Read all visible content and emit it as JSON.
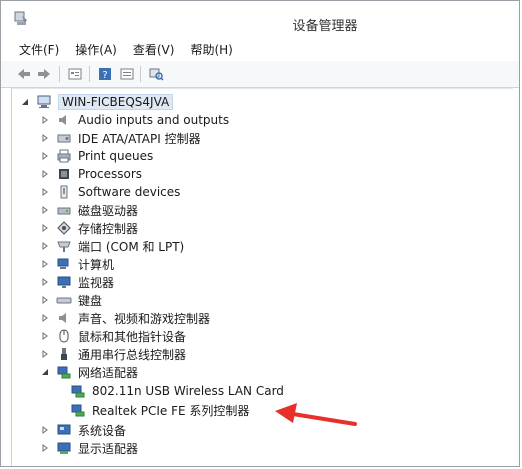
{
  "window": {
    "title": "设备管理器"
  },
  "menu": [
    {
      "label": "文件(F)"
    },
    {
      "label": "操作(A)"
    },
    {
      "label": "查看(V)"
    },
    {
      "label": "帮助(H)"
    }
  ],
  "toolbar": {
    "buttons": [
      "back-icon",
      "forward-icon",
      "properties-icon",
      "help-icon",
      "details-icon",
      "scan-hardware-icon"
    ]
  },
  "tree": {
    "root": "WIN-FICBEQS4JVA",
    "items": [
      {
        "label": "Audio inputs and outputs",
        "icon": "speaker-icon",
        "expanded": false
      },
      {
        "label": "IDE ATA/ATAPI 控制器",
        "icon": "ide-controller-icon",
        "expanded": false
      },
      {
        "label": "Print queues",
        "icon": "printer-icon",
        "expanded": false
      },
      {
        "label": "Processors",
        "icon": "processor-icon",
        "expanded": false
      },
      {
        "label": "Software devices",
        "icon": "software-device-icon",
        "expanded": false
      },
      {
        "label": "磁盘驱动器",
        "icon": "disk-drive-icon",
        "expanded": false
      },
      {
        "label": "存储控制器",
        "icon": "storage-controller-icon",
        "expanded": false
      },
      {
        "label": "端口 (COM 和 LPT)",
        "icon": "port-icon",
        "expanded": false
      },
      {
        "label": "计算机",
        "icon": "computer-icon",
        "expanded": false
      },
      {
        "label": "监视器",
        "icon": "monitor-icon",
        "expanded": false
      },
      {
        "label": "键盘",
        "icon": "keyboard-icon",
        "expanded": false
      },
      {
        "label": "声音、视频和游戏控制器",
        "icon": "sound-icon",
        "expanded": false
      },
      {
        "label": "鼠标和其他指针设备",
        "icon": "mouse-icon",
        "expanded": false
      },
      {
        "label": "通用串行总线控制器",
        "icon": "usb-icon",
        "expanded": false
      },
      {
        "label": "网络适配器",
        "icon": "network-adapter-icon",
        "expanded": true
      },
      {
        "label": "802.11n USB Wireless LAN Card",
        "icon": "network-adapter-icon",
        "child": true
      },
      {
        "label": "Realtek PCIe FE 系列控制器",
        "icon": "network-adapter-icon",
        "child": true
      },
      {
        "label": "系统设备",
        "icon": "system-device-icon",
        "expanded": false
      },
      {
        "label": "显示适配器",
        "icon": "display-adapter-icon",
        "expanded": false
      }
    ]
  },
  "colors": {
    "annotation_arrow": "#e8302b",
    "selection": "#dfe9f5"
  }
}
